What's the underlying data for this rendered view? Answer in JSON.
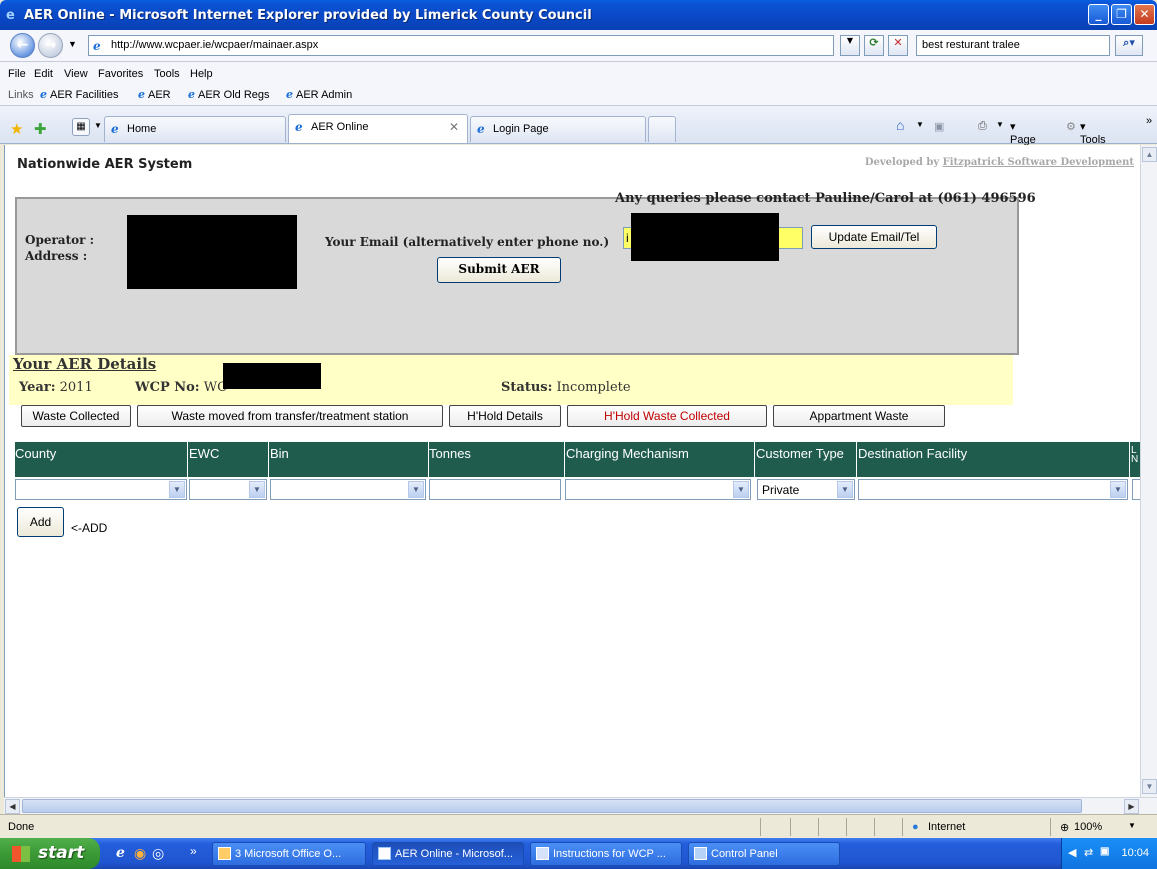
{
  "window": {
    "title": "AER Online - Microsoft Internet Explorer provided by Limerick County Council",
    "controls": [
      "minimize",
      "restore",
      "close"
    ]
  },
  "address_bar": {
    "url": "http://www.wcpaer.ie/wcpaer/mainaer.aspx",
    "search_value": "best resturant tralee"
  },
  "menu": [
    "File",
    "Edit",
    "View",
    "Favorites",
    "Tools",
    "Help"
  ],
  "links": {
    "label": "Links",
    "items": [
      "AER Facilities",
      "AER",
      "AER Old Regs",
      "AER Admin"
    ]
  },
  "tabs": [
    {
      "label": "Home",
      "active": false
    },
    {
      "label": "AER Online",
      "active": true
    },
    {
      "label": "Login Page",
      "active": false
    }
  ],
  "command_bar": {
    "page": "Page",
    "tools": "Tools"
  },
  "page": {
    "title": "Nationwide AER System",
    "developed_by_prefix": "Developed by ",
    "developed_by_link": "Fitzpatrick Software Development",
    "queries": "Any queries please contact Pauline/Carol at (061) 496596",
    "operator_label": "Operator :",
    "address_label": "Address :",
    "email_label": "Your Email (alternatively enter phone no.)",
    "email_value": "i",
    "update_button": "Update Email/Tel",
    "submit_button": "Submit AER",
    "details_heading": "Your AER Details",
    "year_label": "Year:",
    "year_value": "2011",
    "wcp_label": "WCP No:",
    "wcp_value": "WC",
    "status_label": "Status:",
    "status_value": "Incomplete",
    "nav_buttons": [
      {
        "label": "Waste Collected",
        "color": "#000000"
      },
      {
        "label": "Waste moved from transfer/treatment station",
        "color": "#000000"
      },
      {
        "label": "H'Hold Details",
        "color": "#000000"
      },
      {
        "label": "H'Hold Waste Collected",
        "color": "#c00000"
      },
      {
        "label": "Appartment Waste",
        "color": "#000000"
      }
    ],
    "grid_columns": [
      "County",
      "EWC",
      "Bin",
      "Tonnes",
      "Charging Mechanism",
      "Customer Type",
      "Destination Facility",
      "L N"
    ],
    "grid_row": {
      "county": "",
      "ewc": "",
      "bin": "",
      "tonnes": "",
      "charging_mechanism": "",
      "customer_type": "Private",
      "destination_facility": ""
    },
    "add_button": "Add",
    "add_hint": "<-ADD",
    "header_color": "#1f5c4d",
    "details_bg": "#ffffc6"
  },
  "statusbar": {
    "status": "Done",
    "zone": "Internet",
    "zoom": "100%"
  },
  "taskbar": {
    "start": "start",
    "tasks": [
      {
        "label": "3 Microsoft Office O...",
        "active": false
      },
      {
        "label": "AER Online - Microsof...",
        "active": true
      },
      {
        "label": "Instructions for WCP ...",
        "active": false
      },
      {
        "label": "Control Panel",
        "active": false
      }
    ],
    "clock": "10:04"
  }
}
